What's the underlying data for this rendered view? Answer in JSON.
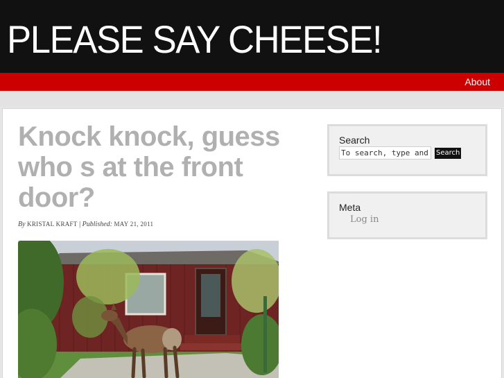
{
  "header": {
    "site_title": "PLEASE SAY CHEESE!"
  },
  "nav": {
    "about": "About"
  },
  "post": {
    "title": "Knock knock, guess who s at the front door?",
    "by_label": "By",
    "author": "KRISTAL KRAFT",
    "separator": "|",
    "published_label": "Published:",
    "date": "MAY 21, 2011"
  },
  "sidebar": {
    "search": {
      "title": "Search",
      "placeholder": "To search, type and hit enter",
      "button": "Search"
    },
    "meta": {
      "title": "Meta",
      "links": [
        "Log in"
      ]
    }
  },
  "colors": {
    "masthead": "#111111",
    "nav_bar": "#cc0000",
    "title_text": "#b0b0b0"
  },
  "image": {
    "subject": "elk standing in front of a red house"
  }
}
